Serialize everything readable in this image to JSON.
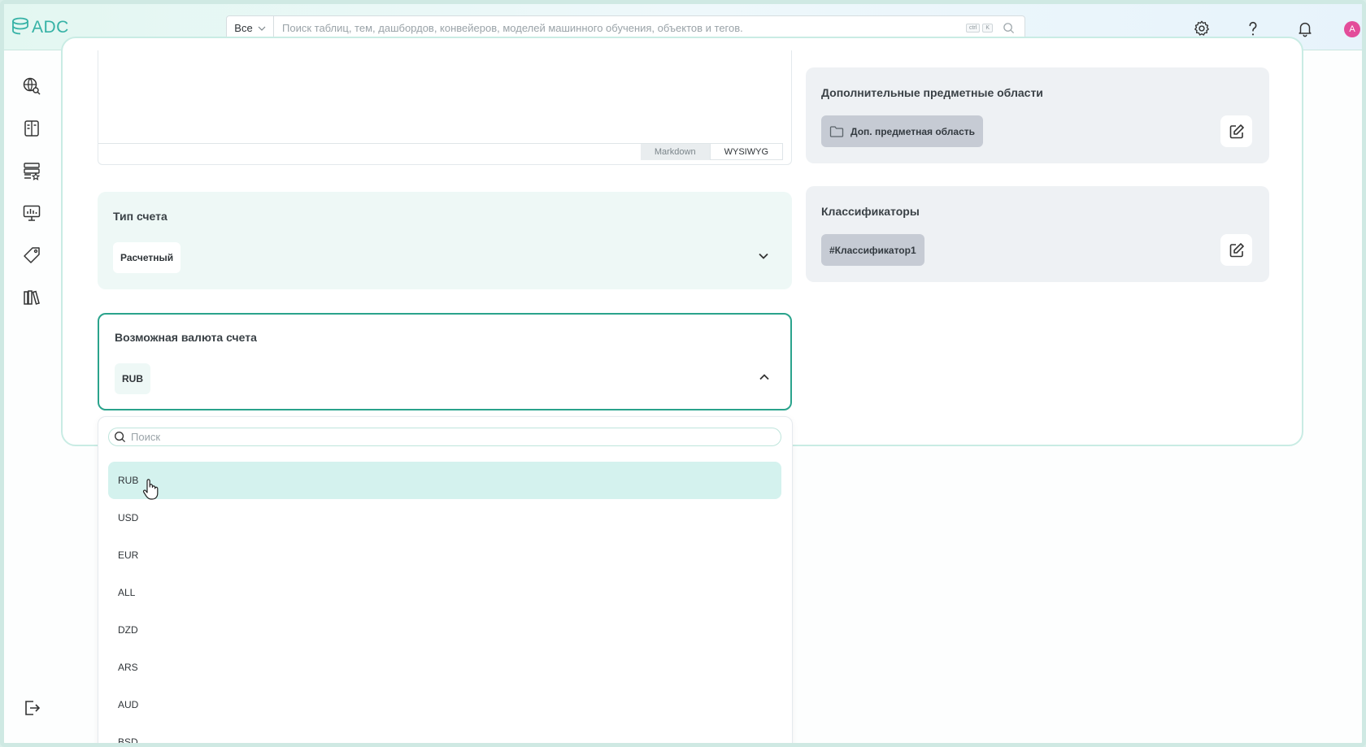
{
  "app": {
    "logo_text": "ADC"
  },
  "header": {
    "scope_label": "Все",
    "search_placeholder": "Поиск таблиц, тем, дашбордов, конвейеров, моделей машинного обучения, объектов и тегов.",
    "kbd_ctrl": "ctrl",
    "kbd_k": "K",
    "avatar_letter": "A"
  },
  "editor": {
    "tab_markdown": "Markdown",
    "tab_wysiwyg": "WYSIWYG"
  },
  "account_type": {
    "title": "Тип счета",
    "value": "Расчетный"
  },
  "currency": {
    "title": "Возможная валюта счета",
    "value": "RUB"
  },
  "domains": {
    "title": "Дополнительные предметные области",
    "tag": "Доп. предметная область"
  },
  "classifiers": {
    "title": "Классификаторы",
    "tag": "#Классификатор1"
  },
  "dropdown": {
    "search_placeholder": "Поиск",
    "options": [
      "RUB",
      "USD",
      "EUR",
      "ALL",
      "DZD",
      "ARS",
      "AUD",
      "BSD"
    ],
    "selected": "RUB"
  },
  "colors": {
    "accent": "#2aa38c",
    "brand": "#36b2a6",
    "avatar": "#e34d9a"
  }
}
